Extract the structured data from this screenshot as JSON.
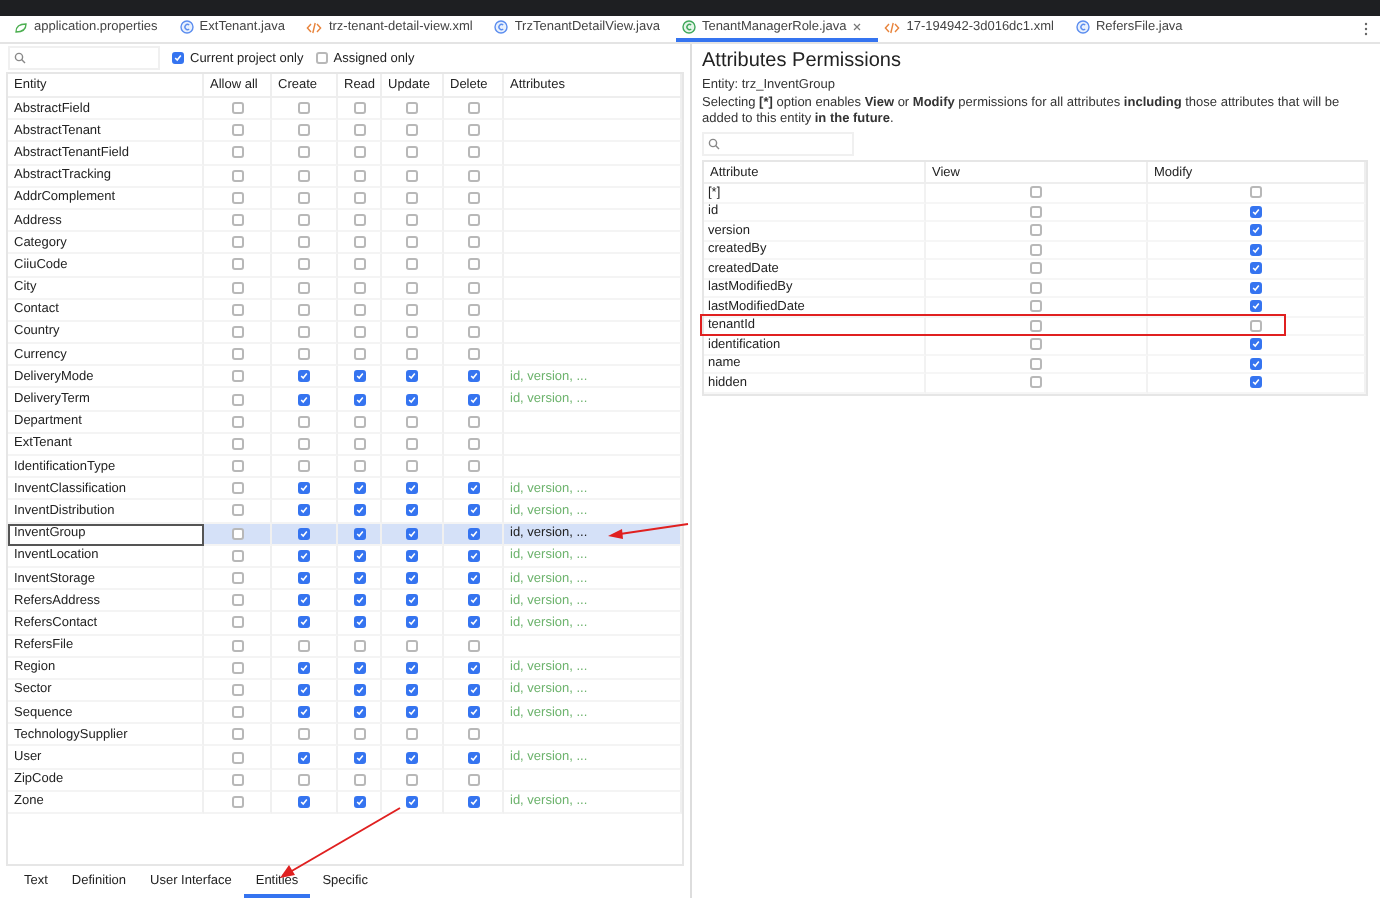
{
  "editor_tabs": [
    {
      "label": "application.properties",
      "kind": "properties",
      "selected": false
    },
    {
      "label": "ExtTenant.java",
      "kind": "java",
      "selected": false
    },
    {
      "label": "trz-tenant-detail-view.xml",
      "kind": "xml",
      "selected": false
    },
    {
      "label": "TrzTenantDetailView.java",
      "kind": "java",
      "selected": false
    },
    {
      "label": "TenantManagerRole.java",
      "kind": "role",
      "selected": true
    },
    {
      "label": "17-194942-3d016dc1.xml",
      "kind": "xml",
      "selected": false
    },
    {
      "label": "RefersFile.java",
      "kind": "java",
      "selected": false
    }
  ],
  "entities": {
    "filters": [
      {
        "label": "Current project only",
        "checked": true
      },
      {
        "label": "Assigned only",
        "checked": false
      }
    ],
    "columns": [
      "Entity",
      "Allow all",
      "Create",
      "Read",
      "Update",
      "Delete",
      "Attributes"
    ],
    "rows": [
      {
        "name": "AbstractField",
        "allow_all": false,
        "create": false,
        "read": false,
        "update": false,
        "delete": false,
        "selected": false
      },
      {
        "name": "AbstractTenant",
        "allow_all": false,
        "create": false,
        "read": false,
        "update": false,
        "delete": false,
        "selected": false
      },
      {
        "name": "AbstractTenantField",
        "allow_all": false,
        "create": false,
        "read": false,
        "update": false,
        "delete": false,
        "selected": false
      },
      {
        "name": "AbstractTracking",
        "allow_all": false,
        "create": false,
        "read": false,
        "update": false,
        "delete": false,
        "selected": false
      },
      {
        "name": "AddrComplement",
        "allow_all": false,
        "create": false,
        "read": false,
        "update": false,
        "delete": false,
        "selected": false
      },
      {
        "name": "Address",
        "allow_all": false,
        "create": false,
        "read": false,
        "update": false,
        "delete": false,
        "selected": false
      },
      {
        "name": "Category",
        "allow_all": false,
        "create": false,
        "read": false,
        "update": false,
        "delete": false,
        "selected": false
      },
      {
        "name": "CiiuCode",
        "allow_all": false,
        "create": false,
        "read": false,
        "update": false,
        "delete": false,
        "selected": false
      },
      {
        "name": "City",
        "allow_all": false,
        "create": false,
        "read": false,
        "update": false,
        "delete": false,
        "selected": false
      },
      {
        "name": "Contact",
        "allow_all": false,
        "create": false,
        "read": false,
        "update": false,
        "delete": false,
        "selected": false
      },
      {
        "name": "Country",
        "allow_all": false,
        "create": false,
        "read": false,
        "update": false,
        "delete": false,
        "selected": false
      },
      {
        "name": "Currency",
        "allow_all": false,
        "create": false,
        "read": false,
        "update": false,
        "delete": false,
        "selected": false
      },
      {
        "name": "DeliveryMode",
        "allow_all": false,
        "create": true,
        "read": true,
        "update": true,
        "delete": true,
        "attributes": "id, version, ...",
        "selected": false
      },
      {
        "name": "DeliveryTerm",
        "allow_all": false,
        "create": true,
        "read": true,
        "update": true,
        "delete": true,
        "attributes": "id, version, ...",
        "selected": false
      },
      {
        "name": "Department",
        "allow_all": false,
        "create": false,
        "read": false,
        "update": false,
        "delete": false,
        "selected": false
      },
      {
        "name": "ExtTenant",
        "allow_all": false,
        "create": false,
        "read": false,
        "update": false,
        "delete": false,
        "selected": false
      },
      {
        "name": "IdentificationType",
        "allow_all": false,
        "create": false,
        "read": false,
        "update": false,
        "delete": false,
        "selected": false
      },
      {
        "name": "InventClassification",
        "allow_all": false,
        "create": true,
        "read": true,
        "update": true,
        "delete": true,
        "attributes": "id, version, ...",
        "selected": false
      },
      {
        "name": "InventDistribution",
        "allow_all": false,
        "create": true,
        "read": true,
        "update": true,
        "delete": true,
        "attributes": "id, version, ...",
        "selected": false
      },
      {
        "name": "InventGroup",
        "allow_all": false,
        "create": true,
        "read": true,
        "update": true,
        "delete": true,
        "attributes": "id, version, ...",
        "selected": true
      },
      {
        "name": "InventLocation",
        "allow_all": false,
        "create": true,
        "read": true,
        "update": true,
        "delete": true,
        "attributes": "id, version, ...",
        "selected": false
      },
      {
        "name": "InventStorage",
        "allow_all": false,
        "create": true,
        "read": true,
        "update": true,
        "delete": true,
        "attributes": "id, version, ...",
        "selected": false
      },
      {
        "name": "RefersAddress",
        "allow_all": false,
        "create": true,
        "read": true,
        "update": true,
        "delete": true,
        "attributes": "id, version, ...",
        "selected": false
      },
      {
        "name": "RefersContact",
        "allow_all": false,
        "create": true,
        "read": true,
        "update": true,
        "delete": true,
        "attributes": "id, version, ...",
        "selected": false
      },
      {
        "name": "RefersFile",
        "allow_all": false,
        "create": false,
        "read": false,
        "update": false,
        "delete": false,
        "selected": false
      },
      {
        "name": "Region",
        "allow_all": false,
        "create": true,
        "read": true,
        "update": true,
        "delete": true,
        "attributes": "id, version, ...",
        "selected": false
      },
      {
        "name": "Sector",
        "allow_all": false,
        "create": true,
        "read": true,
        "update": true,
        "delete": true,
        "attributes": "id, version, ...",
        "selected": false
      },
      {
        "name": "Sequence",
        "allow_all": false,
        "create": true,
        "read": true,
        "update": true,
        "delete": true,
        "attributes": "id, version, ...",
        "selected": false
      },
      {
        "name": "TechnologySupplier",
        "allow_all": false,
        "create": false,
        "read": false,
        "update": false,
        "delete": false,
        "selected": false
      },
      {
        "name": "User",
        "allow_all": false,
        "create": true,
        "read": true,
        "update": true,
        "delete": true,
        "attributes": "id, version, ...",
        "selected": false
      },
      {
        "name": "ZipCode",
        "allow_all": false,
        "create": false,
        "read": false,
        "update": false,
        "delete": false,
        "selected": false
      },
      {
        "name": "Zone",
        "allow_all": false,
        "create": true,
        "read": true,
        "update": true,
        "delete": true,
        "attributes": "id, version, ...",
        "selected": false
      }
    ]
  },
  "attributes_panel": {
    "title": "Attributes Permissions",
    "entity": "Entity:  trz_InventGroup",
    "description": "Selecting **[*]** option enables **View** or **Modify** permissions for all attributes **including** those attributes that will be added to this entity **in the future**.",
    "columns": [
      "Attribute",
      "View",
      "Modify"
    ],
    "rows": [
      {
        "name": "[*]",
        "view": false,
        "modify": false
      },
      {
        "name": "id",
        "view": false,
        "modify": true
      },
      {
        "name": "version",
        "view": false,
        "modify": true
      },
      {
        "name": "createdBy",
        "view": false,
        "modify": true
      },
      {
        "name": "createdDate",
        "view": false,
        "modify": true
      },
      {
        "name": "lastModifiedBy",
        "view": false,
        "modify": true
      },
      {
        "name": "lastModifiedDate",
        "view": false,
        "modify": true
      },
      {
        "name": "tenantId",
        "view": false,
        "modify": false
      },
      {
        "name": "identification",
        "view": false,
        "modify": true
      },
      {
        "name": "name",
        "view": false,
        "modify": true
      },
      {
        "name": "hidden",
        "view": false,
        "modify": true
      }
    ]
  },
  "bottom_tabs": [
    {
      "label": "Text",
      "selected": false
    },
    {
      "label": "Definition",
      "selected": false
    },
    {
      "label": "User Interface",
      "selected": false
    },
    {
      "label": "Entities",
      "selected": true
    },
    {
      "label": "Specific",
      "selected": false
    }
  ],
  "annotations": [
    {
      "kind": "arrow_to_row"
    },
    {
      "kind": "arrow_to_tab"
    },
    {
      "kind": "highlight_box"
    }
  ]
}
